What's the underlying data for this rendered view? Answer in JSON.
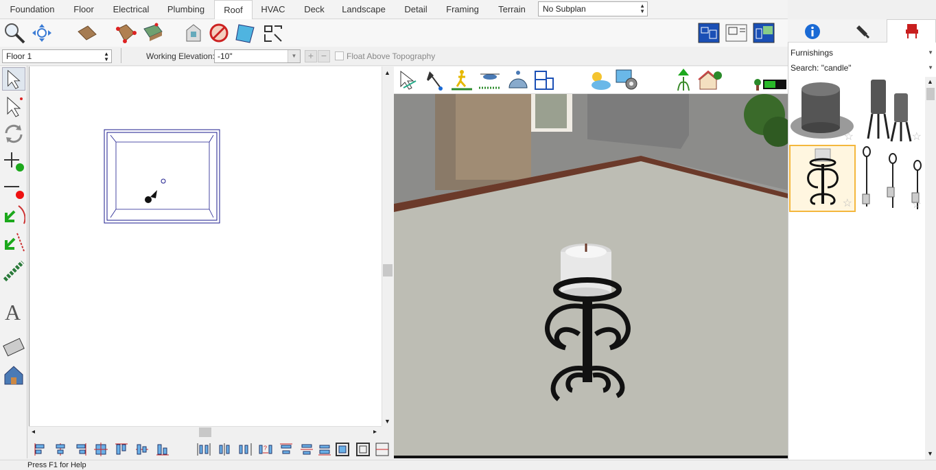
{
  "tabs": [
    "Foundation",
    "Floor",
    "Electrical",
    "Plumbing",
    "Roof",
    "HVAC",
    "Deck",
    "Landscape",
    "Detail",
    "Framing",
    "Terrain"
  ],
  "active_tab": "Roof",
  "subplan": {
    "value": "No Subplan"
  },
  "floor_select": {
    "value": "Floor 1"
  },
  "working_elevation": {
    "label": "Working Elevation:",
    "value": "-10\""
  },
  "float_above": {
    "label": "Float Above Topography",
    "checked": false
  },
  "right_panel": {
    "library": "Furnishings",
    "search": "Search: \"candle\"",
    "thumbnails": [
      {
        "name": "candle-pillar-thumb",
        "selected": false
      },
      {
        "name": "candle-lanterns-thumb",
        "selected": false
      },
      {
        "name": "candle-holder-scroll-thumb",
        "selected": true
      },
      {
        "name": "candle-stakes-thumb",
        "selected": false
      }
    ]
  },
  "status": {
    "text": "Press F1 for Help"
  },
  "colors": {
    "accent_selected": "#f4b73c",
    "plan_line": "#1a1a8c",
    "floor_3d": "#bdbdb4",
    "trim_3d": "#6b3a2a"
  }
}
